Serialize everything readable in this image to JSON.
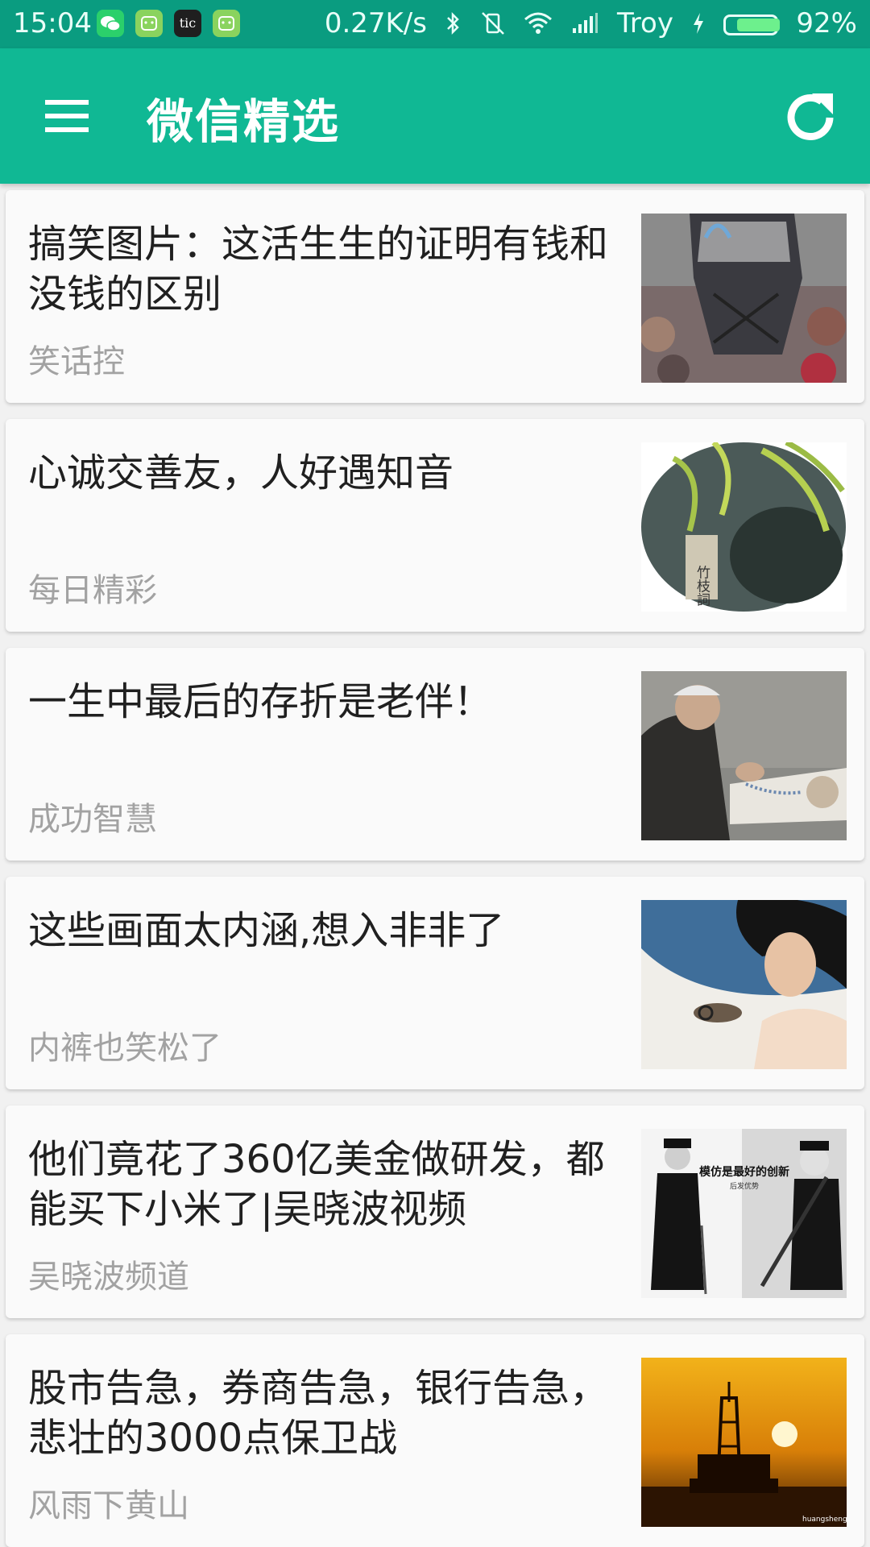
{
  "status_bar": {
    "time": "15:04",
    "app_icons": [
      "wechat-icon",
      "cat-icon",
      "tic-icon",
      "cat-icon"
    ],
    "tic_label": "tic",
    "net_speed": "0.27K/s",
    "carrier": "Troy",
    "battery_percent": "92%",
    "battery_level": 0.92
  },
  "app_bar": {
    "title": "微信精选",
    "menu_icon": "hamburger-menu-icon",
    "refresh_icon": "refresh-icon",
    "color": "#10b894"
  },
  "articles": [
    {
      "title": "搞笑图片：这活生生的证明有钱和没钱的区别",
      "source": "笑话控"
    },
    {
      "title": "心诚交善友，人好遇知音",
      "source": "每日精彩",
      "thumb_text": "竹枝詞"
    },
    {
      "title": "一生中最后的存折是老伴！",
      "source": "成功智慧"
    },
    {
      "title": "这些画面太内涵,想入非非了",
      "source": "内裤也笑松了"
    },
    {
      "title": "他们竟花了360亿美金做研发，都能买下小米了|吴晓波视频",
      "source": "吴晓波频道",
      "thumb_text": "模仿是最好的创新",
      "thumb_subtext": "后发优势"
    },
    {
      "title": "股市告急，券商告急，银行告急，悲壮的3000点保卫战",
      "source": "风雨下黄山",
      "thumb_text": "huangsheng"
    }
  ]
}
